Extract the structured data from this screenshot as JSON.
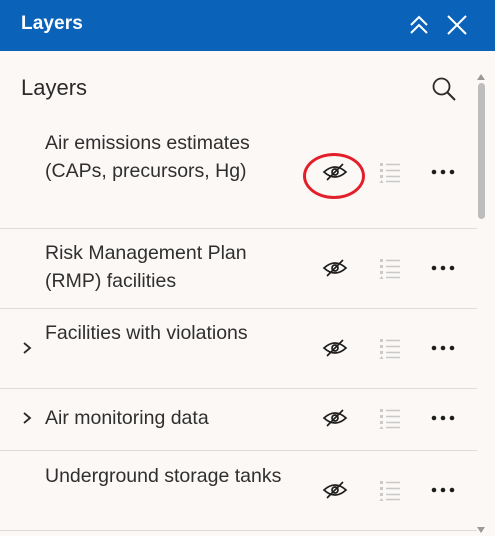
{
  "header": {
    "title": "Layers",
    "collapse_icon": "chevron-double-up-icon",
    "close_icon": "close-icon",
    "background_color": "#0a63b8"
  },
  "panel": {
    "title": "Layers",
    "search_icon": "search-icon"
  },
  "layers": [
    {
      "label": "Air emissions estimates (CAPs, precursors, Hg)",
      "expandable": false,
      "visibility_icon": "eye-hidden-icon",
      "legend_icon": "legend-list-icon",
      "more_icon": "ellipsis-icon",
      "highlighted": true
    },
    {
      "label": "Risk Management Plan (RMP) facilities",
      "expandable": false,
      "visibility_icon": "eye-hidden-icon",
      "legend_icon": "legend-list-icon",
      "more_icon": "ellipsis-icon",
      "highlighted": false
    },
    {
      "label": "Facilities with violations",
      "expandable": true,
      "visibility_icon": "eye-hidden-icon",
      "legend_icon": "legend-list-icon",
      "more_icon": "ellipsis-icon",
      "highlighted": false
    },
    {
      "label": "Air monitoring data",
      "expandable": true,
      "visibility_icon": "eye-hidden-icon",
      "legend_icon": "legend-list-icon",
      "more_icon": "ellipsis-icon",
      "highlighted": false
    },
    {
      "label": "Underground storage tanks",
      "expandable": false,
      "visibility_icon": "eye-hidden-icon",
      "legend_icon": "legend-list-icon",
      "more_icon": "ellipsis-icon",
      "highlighted": false
    }
  ],
  "highlight_color": "#e3202a"
}
